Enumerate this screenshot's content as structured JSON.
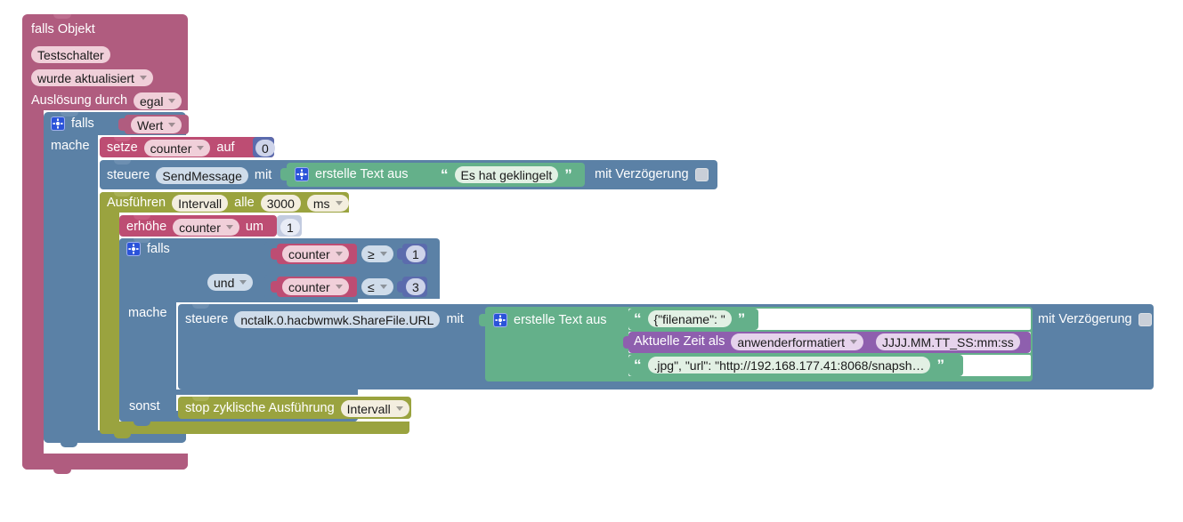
{
  "editor": {
    "name": "blockly-workspace",
    "background": "#ffffff",
    "grid_color": "#d8d8d8"
  },
  "colors": {
    "trigger_rose": "#b05c7f",
    "trigger_rose_light": "#bd6d8e",
    "control_blue": "#5b81a6",
    "variable_magenta": "#bd4d73",
    "timer_olive": "#9aa33f",
    "text_green": "#64b08a",
    "time_purple": "#8e5fae",
    "number_indigo": "#5b6bad",
    "gear_blue": "#2b53d9"
  },
  "blocks": {
    "trigger": {
      "title": "falls Objekt",
      "object_id": "Testschalter",
      "condition": "wurde aktualisiert",
      "trigger_by_label": "Auslösung durch",
      "trigger_by_value": "egal"
    },
    "outer_if": {
      "if_label": "falls",
      "condition_value": "Wert",
      "do_label": "mache"
    },
    "set_counter": {
      "verb": "setze",
      "variable": "counter",
      "preposition": "auf",
      "value": "0"
    },
    "send_message": {
      "verb": "steuere",
      "target": "SendMessage",
      "with_label": "mit",
      "text_builder_label": "erstelle Text aus",
      "text_value": "Es hat geklingelt",
      "delay_label": "mit Verzögerung",
      "delay_checked": false
    },
    "interval": {
      "verb": "Ausführen",
      "name": "Intervall",
      "every_label": "alle",
      "period": "3000",
      "unit": "ms"
    },
    "increment": {
      "verb": "erhöhe",
      "variable": "counter",
      "preposition": "um",
      "value": "1"
    },
    "inner_if": {
      "if_label": "falls",
      "do_label": "mache",
      "else_label": "sonst",
      "operator_join": "und",
      "conditions": [
        {
          "variable": "counter",
          "operator": "≥",
          "value": "1"
        },
        {
          "variable": "counter",
          "operator": "≤",
          "value": "3"
        }
      ]
    },
    "share_file": {
      "verb": "steuere",
      "target": "nctalk.0.hacbwmwk.ShareFile.URL",
      "with_label": "mit",
      "text_builder_label": "erstelle Text aus",
      "delay_label": "mit Verzögerung",
      "delay_checked": false,
      "parts": [
        {
          "type": "text",
          "value": "{\"filename\": \""
        },
        {
          "type": "time",
          "label": "Aktuelle Zeit als",
          "format_mode": "anwenderformatiert",
          "format": "JJJJ.MM.TT_SS:mm:ss"
        },
        {
          "type": "text",
          "value": ".jpg\", \"url\": \"http://192.168.177.41:8068/snapsh…"
        }
      ]
    },
    "stop_interval": {
      "verb": "stop zyklische Ausführung",
      "name": "Intervall"
    }
  }
}
